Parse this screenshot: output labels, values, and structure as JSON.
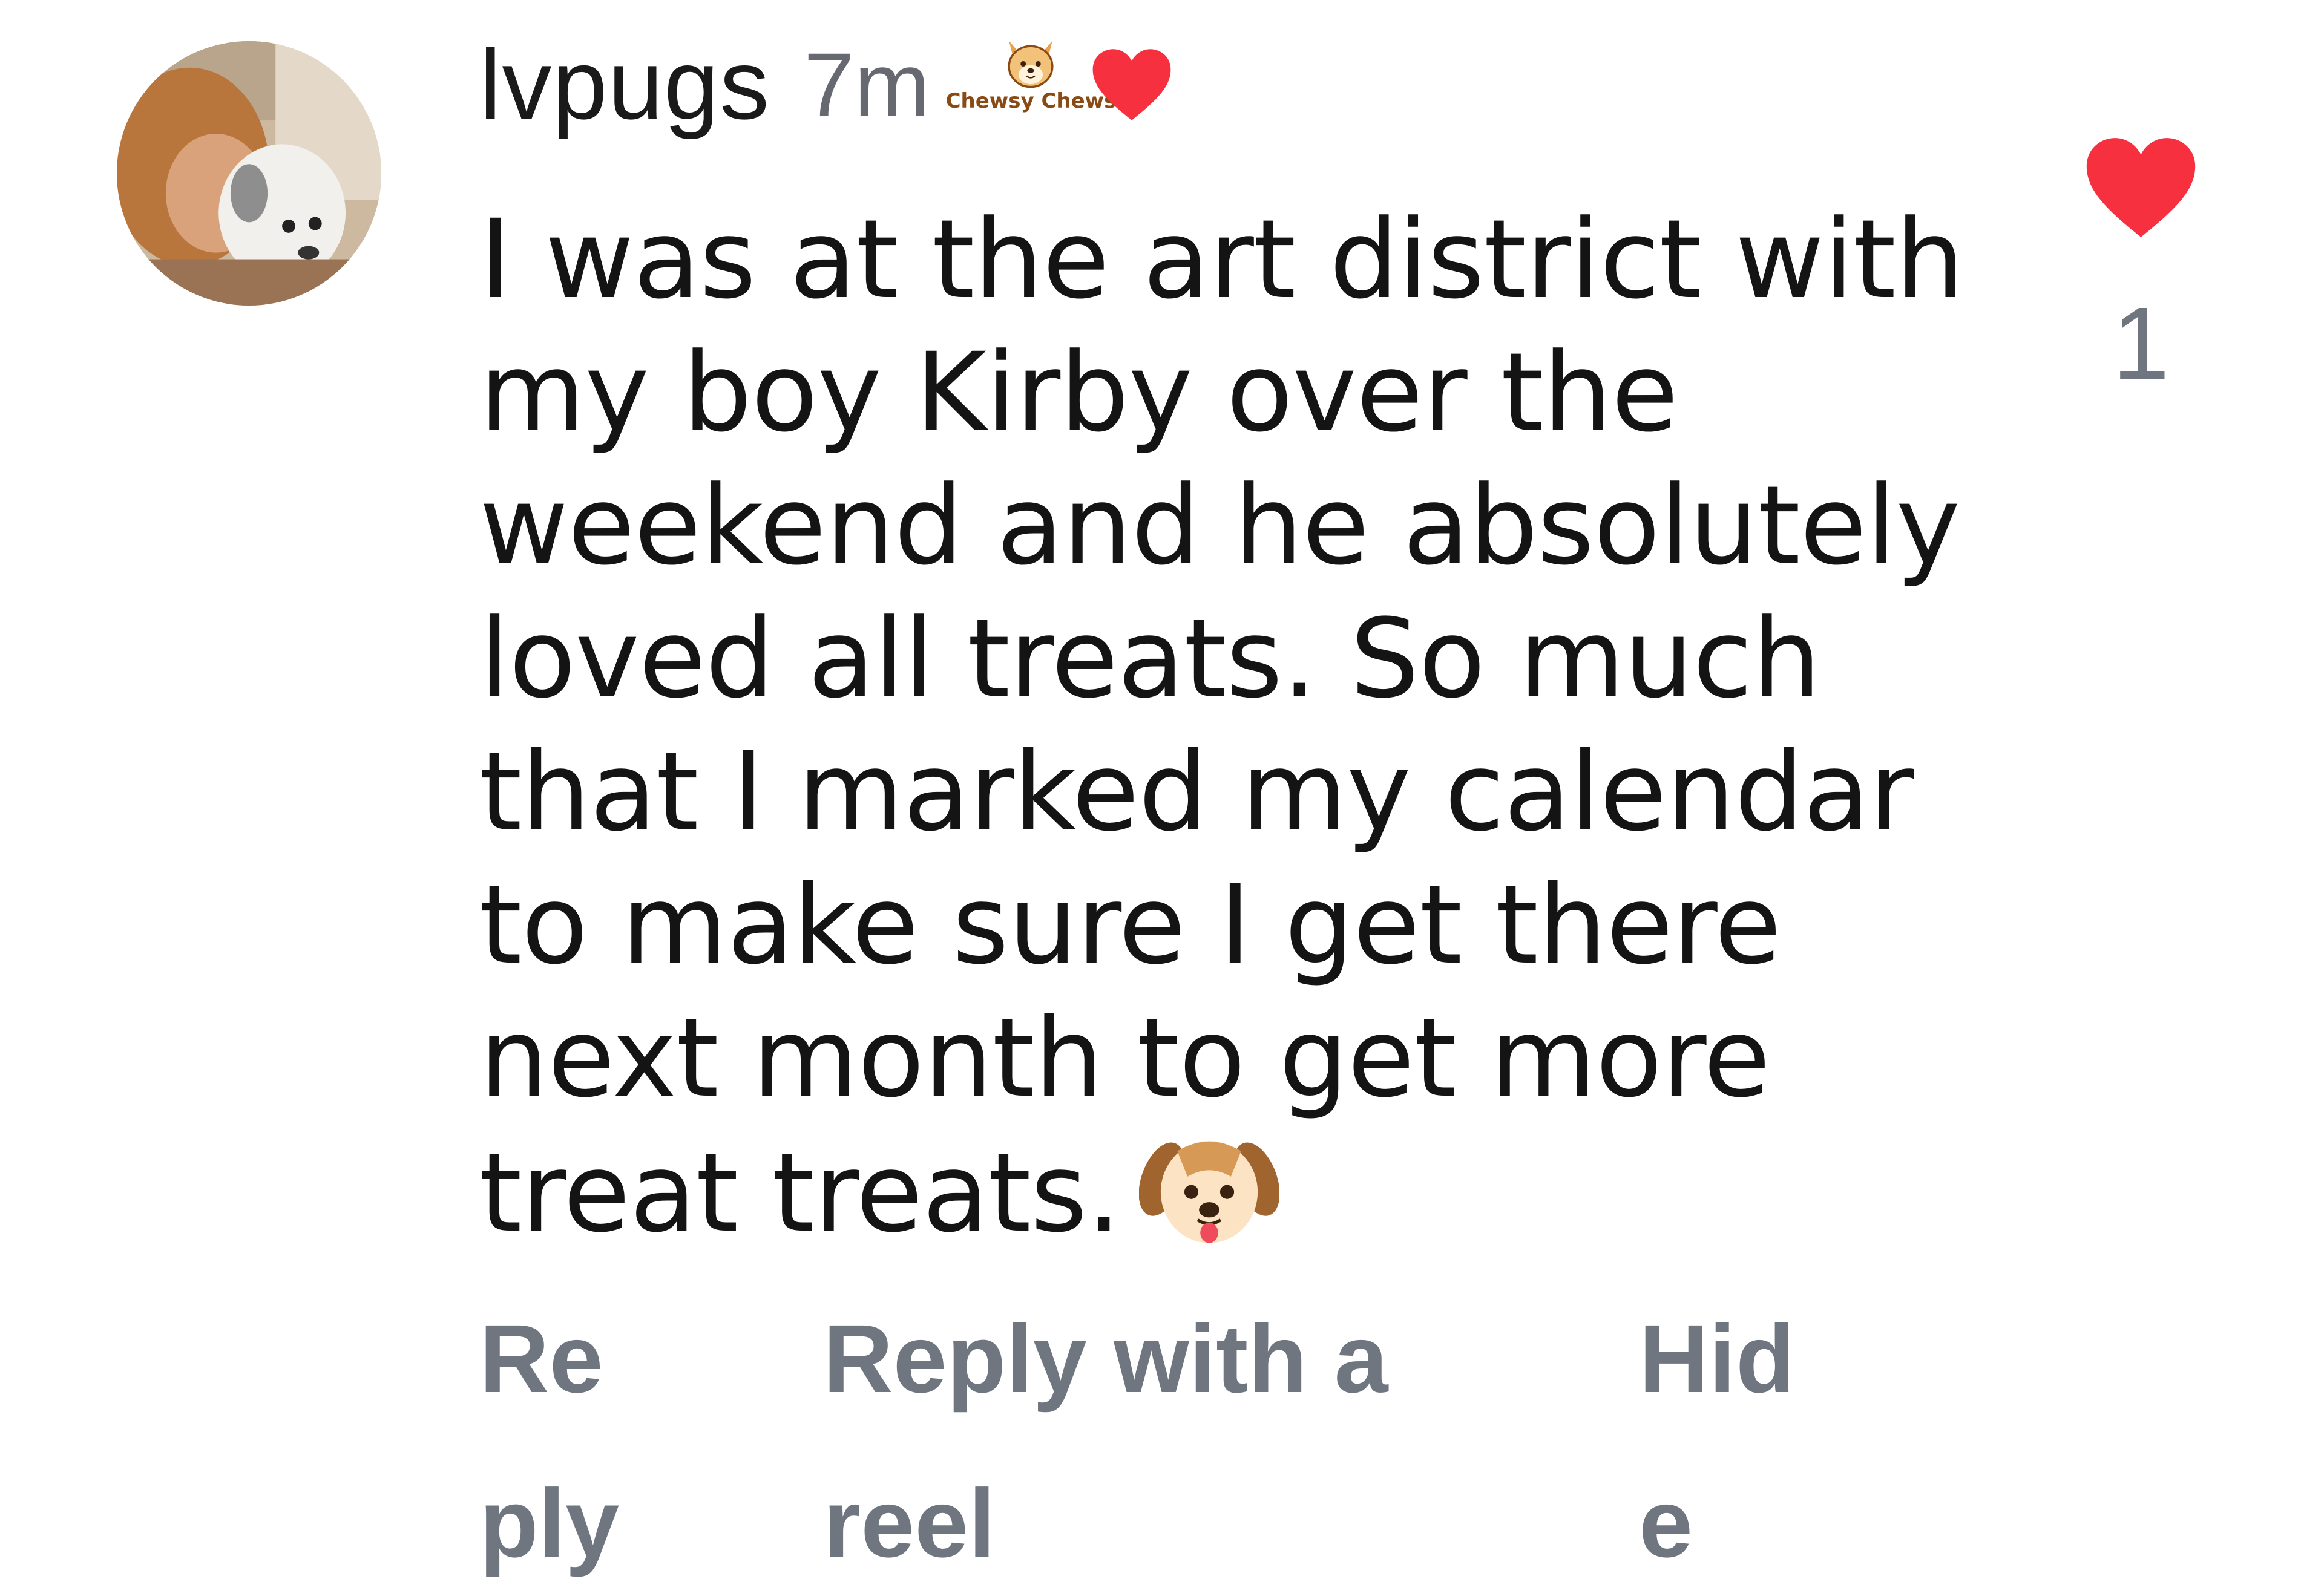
{
  "comment": {
    "username": "lvpugs",
    "timestamp": "7m",
    "badge": {
      "icon": "dog-face-icon",
      "text": "Chewsy Chews"
    },
    "creator_liked_icon": "heart-icon",
    "body": "I was at the art district with my boy Kirby over the weekend and he absolutely loved all treats. So much that I marked my calendar to make sure I get there next month to get more treat treats.",
    "body_emoji": "dog-face-emoji",
    "actions": {
      "reply": "Reply",
      "reply_with_reel": "Reply with a reel",
      "hide": "Hide"
    },
    "like": {
      "icon": "heart-icon",
      "count": "1",
      "liked": true
    }
  },
  "colors": {
    "heart": "#f7303f",
    "secondary_text": "#6f7680",
    "primary_text": "#141414"
  }
}
